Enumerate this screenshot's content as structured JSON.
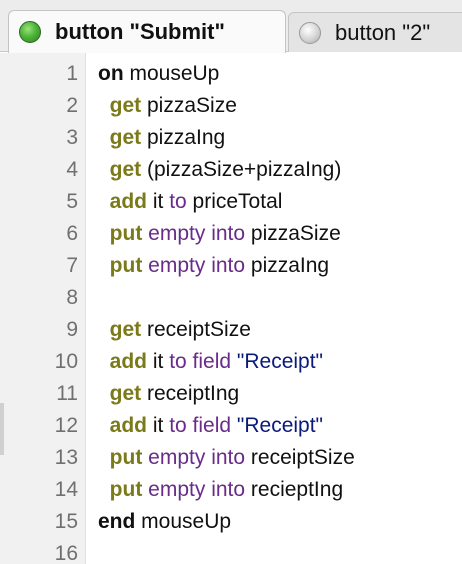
{
  "tabs": [
    {
      "label": "button \"Submit\"",
      "active": true,
      "status_color": "#4fb53a"
    },
    {
      "label": "button \"2\"",
      "active": false,
      "status_color": "#c8c8c8"
    }
  ],
  "colors": {
    "keyword": "#111111",
    "command": "#7a7a1a",
    "control": "#6a2b8a",
    "property": "#0a1a7a",
    "line_number": "#707070"
  },
  "lines": [
    {
      "num": "1",
      "tokens": [
        {
          "t": "on",
          "c": "kw"
        },
        {
          "t": " mouseUp",
          "c": "plain"
        }
      ]
    },
    {
      "num": "2",
      "tokens": [
        {
          "t": "  get",
          "c": "cmd"
        },
        {
          "t": " pizzaSize",
          "c": "plain"
        }
      ]
    },
    {
      "num": "3",
      "tokens": [
        {
          "t": "  get",
          "c": "cmd"
        },
        {
          "t": " pizzaIng",
          "c": "plain"
        }
      ]
    },
    {
      "num": "4",
      "tokens": [
        {
          "t": "  get",
          "c": "cmd"
        },
        {
          "t": " (pizzaSize+pizzaIng)",
          "c": "plain"
        }
      ]
    },
    {
      "num": "5",
      "tokens": [
        {
          "t": "  add",
          "c": "cmd"
        },
        {
          "t": " it ",
          "c": "plain"
        },
        {
          "t": "to",
          "c": "ctl"
        },
        {
          "t": " priceTotal",
          "c": "plain"
        }
      ]
    },
    {
      "num": "6",
      "tokens": [
        {
          "t": "  put",
          "c": "cmd"
        },
        {
          "t": " ",
          "c": "plain"
        },
        {
          "t": "empty into",
          "c": "ctl"
        },
        {
          "t": " pizzaSize",
          "c": "plain"
        }
      ]
    },
    {
      "num": "7",
      "tokens": [
        {
          "t": "  put",
          "c": "cmd"
        },
        {
          "t": " ",
          "c": "plain"
        },
        {
          "t": "empty into",
          "c": "ctl"
        },
        {
          "t": " pizzaIng",
          "c": "plain"
        }
      ]
    },
    {
      "num": "8",
      "tokens": []
    },
    {
      "num": "9",
      "tokens": [
        {
          "t": "  get",
          "c": "cmd"
        },
        {
          "t": " receiptSize",
          "c": "plain"
        }
      ]
    },
    {
      "num": "10",
      "tokens": [
        {
          "t": "  add",
          "c": "cmd"
        },
        {
          "t": " it ",
          "c": "plain"
        },
        {
          "t": "to field",
          "c": "ctl"
        },
        {
          "t": " \"Receipt\"",
          "c": "str"
        }
      ]
    },
    {
      "num": "11",
      "tokens": [
        {
          "t": "  get",
          "c": "cmd"
        },
        {
          "t": " receiptIng",
          "c": "plain"
        }
      ]
    },
    {
      "num": "12",
      "tokens": [
        {
          "t": "  add",
          "c": "cmd"
        },
        {
          "t": " it ",
          "c": "plain"
        },
        {
          "t": "to field",
          "c": "ctl"
        },
        {
          "t": " \"Receipt\"",
          "c": "str"
        }
      ]
    },
    {
      "num": "13",
      "tokens": [
        {
          "t": "  put",
          "c": "cmd"
        },
        {
          "t": " ",
          "c": "plain"
        },
        {
          "t": "empty into",
          "c": "ctl"
        },
        {
          "t": " receiptSize",
          "c": "plain"
        }
      ]
    },
    {
      "num": "14",
      "tokens": [
        {
          "t": "  put",
          "c": "cmd"
        },
        {
          "t": " ",
          "c": "plain"
        },
        {
          "t": "empty into",
          "c": "ctl"
        },
        {
          "t": " recieptIng",
          "c": "plain"
        }
      ]
    },
    {
      "num": "15",
      "tokens": [
        {
          "t": "end",
          "c": "kw"
        },
        {
          "t": " mouseUp",
          "c": "plain"
        }
      ]
    },
    {
      "num": "16",
      "tokens": []
    }
  ]
}
